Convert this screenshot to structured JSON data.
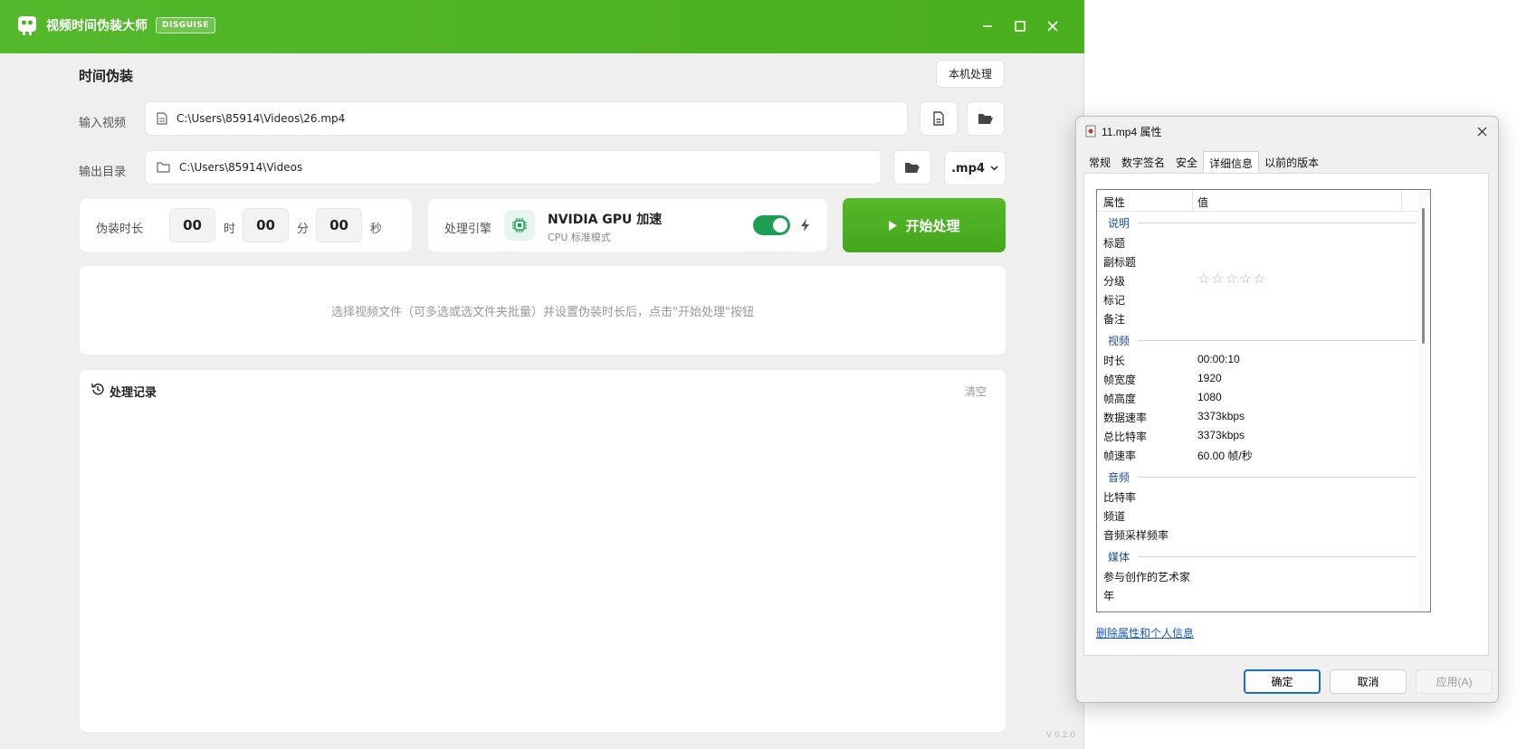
{
  "app": {
    "title": "视频时间伪装大师",
    "badge": "DISGUISE",
    "section_title": "时间伪装",
    "local_button": "本机处理",
    "version": "V 0.2.0",
    "accent_color": "#4cb022"
  },
  "input": {
    "label": "输入视频",
    "path": "C:\\Users\\85914\\Videos\\26.mp4"
  },
  "output": {
    "label": "输出目录",
    "path": "C:\\Users\\85914\\Videos",
    "format": ".mp4"
  },
  "duration": {
    "label": "伪装时长",
    "hours": "00",
    "hours_unit": "时",
    "minutes": "00",
    "minutes_unit": "分",
    "seconds": "00",
    "seconds_unit": "秒"
  },
  "engine": {
    "label": "处理引擎",
    "name": "NVIDIA GPU 加速",
    "mode": "CPU 标准模式",
    "toggle_on": true
  },
  "start_button": "开始处理",
  "hint": "选择视频文件（可多选或选文件夹批量）并设置伪装时长后，点击\"开始处理\"按钮",
  "history": {
    "title": "处理记录",
    "clear": "清空"
  },
  "dialog": {
    "title": "11.mp4 属性",
    "tabs": [
      "常规",
      "数字签名",
      "安全",
      "详细信息",
      "以前的版本"
    ],
    "active_tab": 3,
    "col_property": "属性",
    "col_value": "值",
    "groups": {
      "description": "说明",
      "video": "视频",
      "audio": "音频",
      "media": "媒体"
    },
    "desc_rows": [
      {
        "name": "标题",
        "value": ""
      },
      {
        "name": "副标题",
        "value": ""
      },
      {
        "name": "分级",
        "value": "☆☆☆☆☆"
      },
      {
        "name": "标记",
        "value": ""
      },
      {
        "name": "备注",
        "value": ""
      }
    ],
    "video_rows": [
      {
        "name": "时长",
        "value": "00:00:10"
      },
      {
        "name": "帧宽度",
        "value": "1920"
      },
      {
        "name": "帧高度",
        "value": "1080"
      },
      {
        "name": "数据速率",
        "value": "3373kbps"
      },
      {
        "name": "总比特率",
        "value": "3373kbps"
      },
      {
        "name": "帧速率",
        "value": "60.00 帧/秒"
      }
    ],
    "audio_rows": [
      {
        "name": "比特率",
        "value": ""
      },
      {
        "name": "频道",
        "value": ""
      },
      {
        "name": "音频采样频率",
        "value": ""
      }
    ],
    "media_rows": [
      {
        "name": "参与创作的艺术家",
        "value": ""
      },
      {
        "name": "年",
        "value": ""
      }
    ],
    "remove_link": "删除属性和个人信息",
    "ok": "确定",
    "cancel": "取消",
    "apply": "应用(A)"
  }
}
